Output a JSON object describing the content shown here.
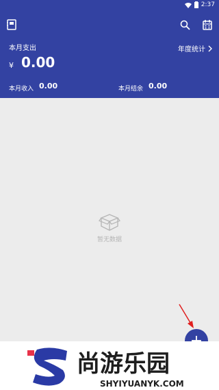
{
  "status_bar": {
    "time": "2:37"
  },
  "summary": {
    "month_expense_label": "本月支出",
    "currency_symbol": "¥",
    "month_expense_value": "0.00",
    "yearly_stats_label": "年度统计",
    "month_income_label": "本月收入",
    "month_income_value": "0.00",
    "month_balance_label": "本月结余",
    "month_balance_value": "0.00"
  },
  "empty": {
    "text": "暂无数据"
  },
  "fab": {
    "label": "+"
  },
  "watermark": {
    "brand_cn": "尚游乐园",
    "brand_en": "SHYIYUANYK.COM"
  },
  "colors": {
    "primary": "#3342a2",
    "background": "#ececec",
    "arrow": "#e02020"
  },
  "icons": [
    "notebook-icon",
    "search-icon",
    "calendar-icon",
    "wifi-icon",
    "battery-icon",
    "chevron-right-icon",
    "empty-box-icon"
  ]
}
